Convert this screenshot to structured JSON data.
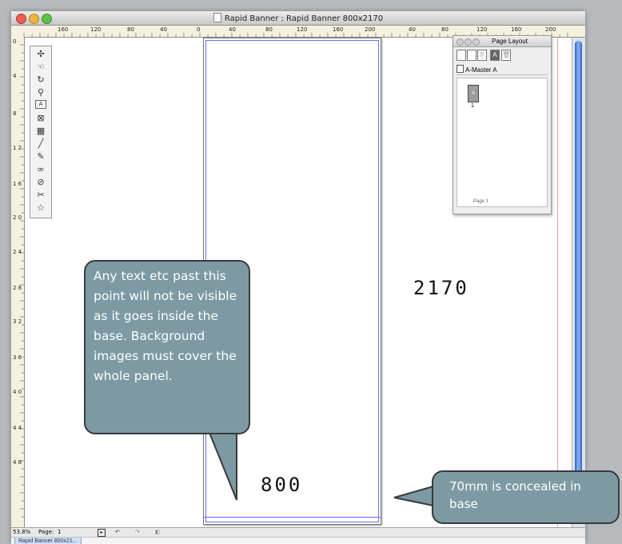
{
  "window": {
    "title": "Rapid Banner : Rapid Banner 800x2170",
    "traffic_colors": [
      "#ee5e56",
      "#f1b53f",
      "#5fc04a"
    ]
  },
  "rulers": {
    "horizontal_ticks": [
      "160",
      "120",
      "80",
      "40",
      "0",
      "40",
      "80",
      "120",
      "160",
      "200",
      "40",
      "80",
      "120",
      "160",
      "200"
    ],
    "vertical_ticks": [
      "0",
      "4",
      "8",
      "1 2",
      "1 6",
      "2 0",
      "2 4",
      "2 8",
      "3 2",
      "3 6",
      "4 0",
      "4 4",
      "4 8"
    ]
  },
  "toolbox": {
    "tools": [
      {
        "name": "select-tool-icon",
        "glyph": "✣"
      },
      {
        "name": "hand-tool-icon",
        "glyph": "☜"
      },
      {
        "name": "rotate-tool-icon",
        "glyph": "↻"
      },
      {
        "name": "zoom-tool-icon",
        "glyph": "⚲"
      },
      {
        "name": "text-box-tool-icon",
        "glyph": "A"
      },
      {
        "name": "picture-box-tool-icon",
        "glyph": "⊠"
      },
      {
        "name": "table-tool-icon",
        "glyph": "▦"
      },
      {
        "name": "line-tool-icon",
        "glyph": "╱"
      },
      {
        "name": "bezier-tool-icon",
        "glyph": "✎"
      },
      {
        "name": "link-tool-icon",
        "glyph": "∞"
      },
      {
        "name": "unlink-tool-icon",
        "glyph": "⊘"
      },
      {
        "name": "scissors-tool-icon",
        "glyph": "✂"
      },
      {
        "name": "star-tool-icon",
        "glyph": "☆"
      }
    ]
  },
  "page_layout_panel": {
    "title": "Page Layout",
    "master": "A-Master A",
    "thumb_label": "A",
    "thumb_number": "1",
    "page_count": "Page 1"
  },
  "status_bar": {
    "zoom": "53.8%",
    "page_label": "Page:",
    "page_value": "1"
  },
  "taskbar": {
    "tab_label": "Rapid Banner 800x21..."
  },
  "annotations": {
    "callout_left": "Any text etc past this point will not be visible as it goes inside the base. Background images must cover the whole panel.",
    "height_label": "2170",
    "width_label": "800",
    "callout_right": "70mm is concealed in base",
    "bubble_color": "#7d9aa4"
  }
}
